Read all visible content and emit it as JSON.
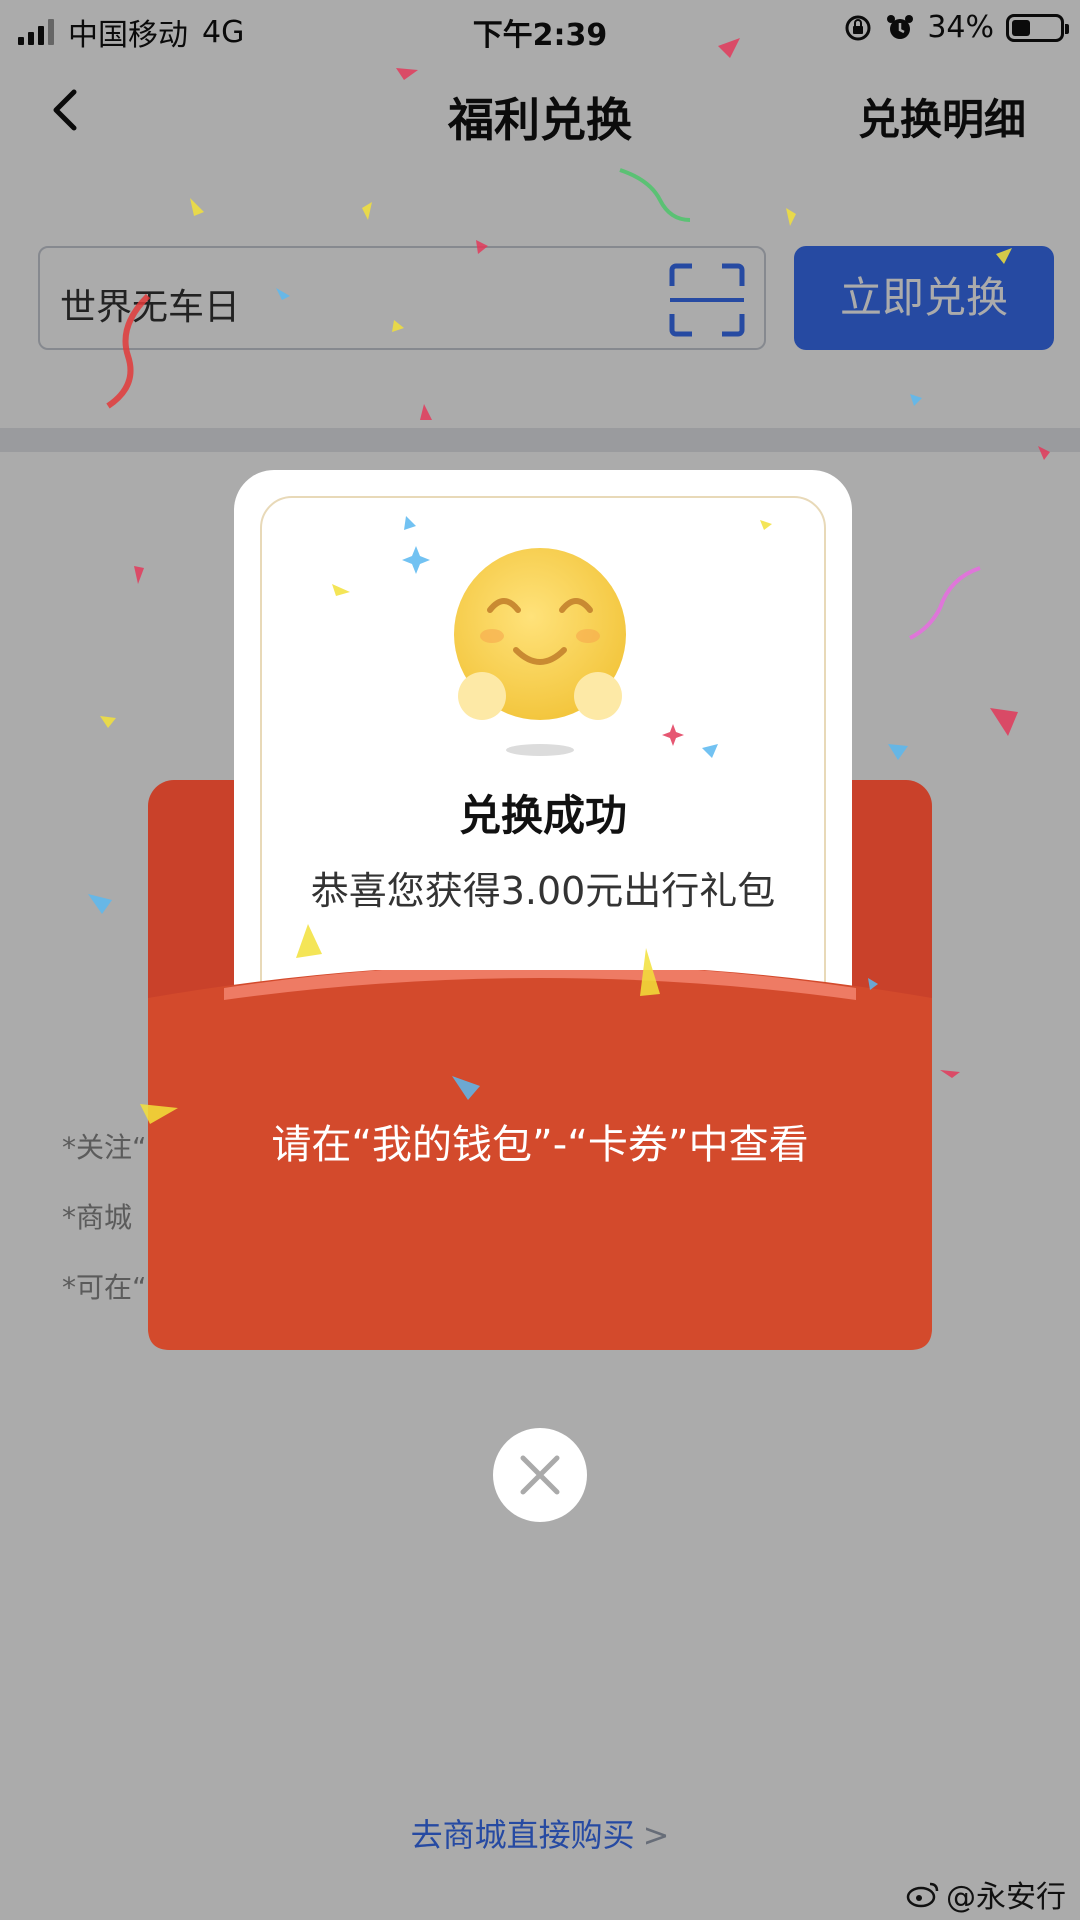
{
  "status_bar": {
    "carrier": "中国移动",
    "network": "4G",
    "time": "下午2:39",
    "battery": "34%",
    "battery_level": 0.34
  },
  "nav": {
    "title": "福利兑换",
    "detail_link": "兑换明细"
  },
  "redeem": {
    "code_value": "世界无车日",
    "button": "立即兑换"
  },
  "notes": [
    "*关注“",
    "*商城",
    "*可在“"
  ],
  "shop_link": "去商城直接购买",
  "shop_link_chevron": ">",
  "modal": {
    "title": "兑换成功",
    "prize_text": "恭喜您获得3.00元出行礼包",
    "wallet_hint": "请在“我的钱包”-“卡券”中查看"
  },
  "watermark": "@永安行",
  "colors": {
    "accent_blue": "#3a6ff2",
    "envelope_red": "#d34a2c",
    "envelope_dark": "#c9412a"
  }
}
